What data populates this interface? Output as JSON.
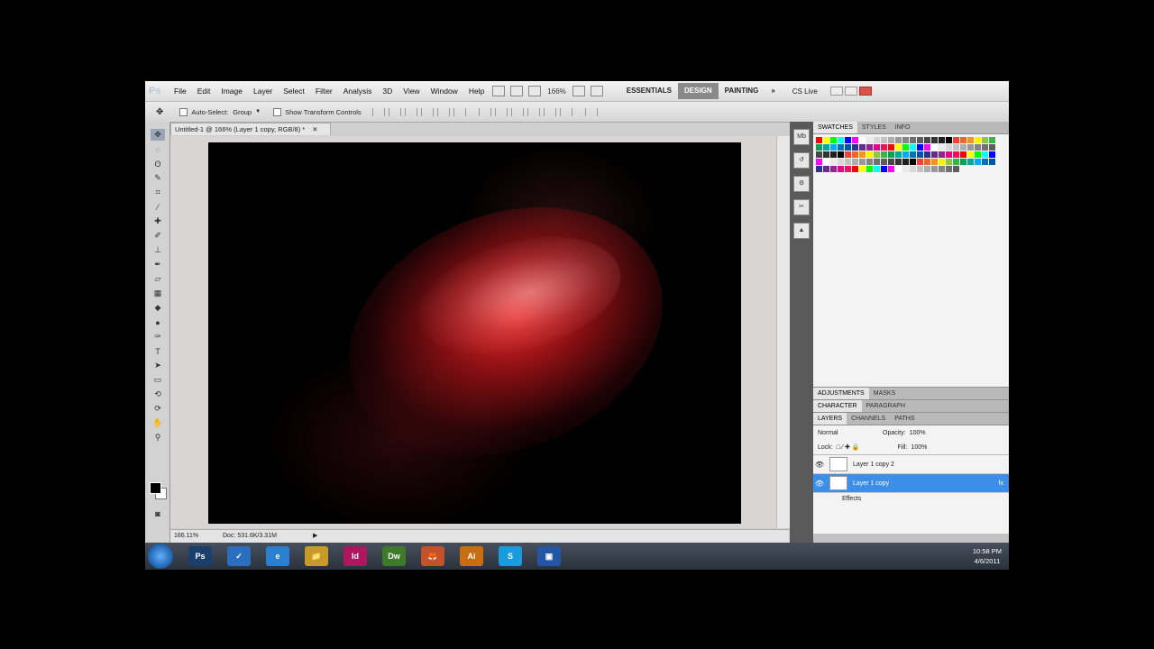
{
  "app": {
    "logo": "Ps"
  },
  "menu": [
    "File",
    "Edit",
    "Image",
    "Layer",
    "Select",
    "Filter",
    "Analysis",
    "3D",
    "View",
    "Window",
    "Help"
  ],
  "zoom_display": "166%",
  "workspaces": [
    "ESSENTIALS",
    "DESIGN",
    "PAINTING"
  ],
  "workspace_more": "»",
  "cslive": "CS Live",
  "options": {
    "auto_select_label": "Auto-Select:",
    "auto_select_value": "Group",
    "show_transform": "Show Transform Controls"
  },
  "document": {
    "tab_title": "Untitled-1 @ 166% (Layer 1 copy, RGB/8) *"
  },
  "statusbar": {
    "zoom": "166.11%",
    "doc": "Doc: 531.6K/3.31M"
  },
  "panels": {
    "top_tabs": [
      "SWATCHES",
      "STYLES",
      "INFO"
    ],
    "adjust_tabs": [
      "ADJUSTMENTS",
      "MASKS"
    ],
    "char_tabs": [
      "CHARACTER",
      "PARAGRAPH"
    ],
    "layer_tabs": [
      "LAYERS",
      "CHANNELS",
      "PATHS"
    ]
  },
  "layers": {
    "blend_mode": "Normal",
    "opacity_label": "Opacity:",
    "opacity": "100%",
    "lock_label": "Lock:",
    "fill_label": "Fill:",
    "fill": "100%",
    "rows": [
      {
        "name": "Layer 1 copy 2",
        "selected": false
      },
      {
        "name": "Layer 1 copy",
        "selected": true
      }
    ],
    "effects_label": "Effects"
  },
  "taskbar": {
    "icons": [
      "Ps",
      "✓",
      "e",
      "📁",
      "Id",
      "Dw",
      "🦊",
      "Ai",
      "S",
      "▣"
    ],
    "time": "10:58 PM",
    "date": "4/6/2011"
  },
  "swatch_colors": [
    "#ff0000",
    "#ffff00",
    "#00ff00",
    "#00ffff",
    "#0000ff",
    "#ff00ff",
    "#ffffff",
    "#ebebeb",
    "#d6d6d6",
    "#c2c2c2",
    "#adadad",
    "#999999",
    "#858585",
    "#707070",
    "#5c5c5c",
    "#474747",
    "#333333",
    "#1f1f1f",
    "#000000",
    "#ef4136",
    "#f26522",
    "#f7941d",
    "#fff200",
    "#8dc63f",
    "#39b54a",
    "#00a651",
    "#00a99d",
    "#00aeef",
    "#0072bc",
    "#0054a6",
    "#2e3192",
    "#662d91",
    "#92278f",
    "#ec008c",
    "#ed145b"
  ]
}
